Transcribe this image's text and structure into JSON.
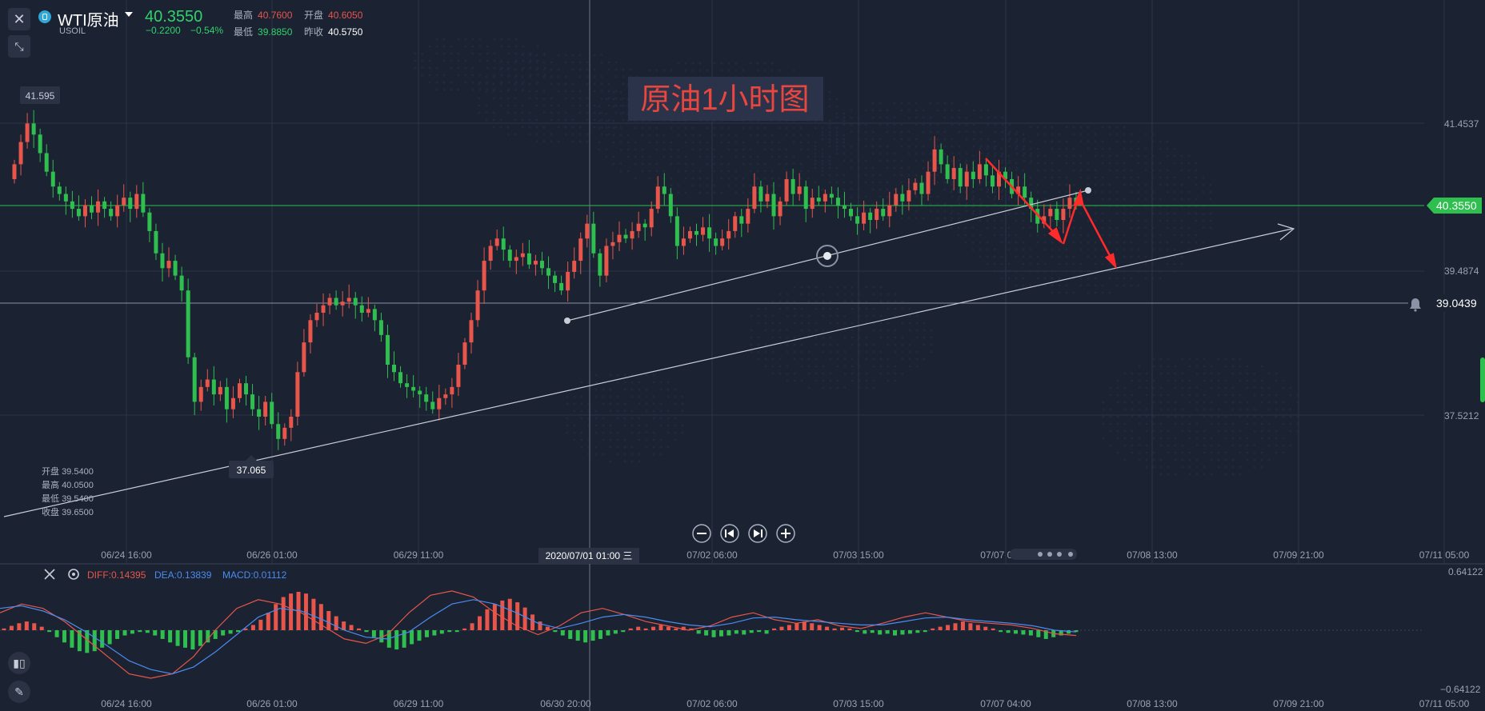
{
  "symbol": {
    "name": "WTI原油",
    "code": "USOIL"
  },
  "quote": {
    "price": "40.3550",
    "change": "−0.2200",
    "change_pct": "−0.54%",
    "high_label": "最高",
    "high": "40.7600",
    "open_label": "开盘",
    "open": "40.6050",
    "low_label": "最低",
    "low": "39.8850",
    "prev_close_label": "昨收",
    "prev_close": "40.5750"
  },
  "annotation": {
    "title": "原油1小时图"
  },
  "hover_ohlc": {
    "open_label": "开盘",
    "open": "39.5400",
    "high_label": "最高",
    "high": "40.0500",
    "low_label": "最低",
    "low": "39.5400",
    "close_label": "收盘",
    "close": "39.6500"
  },
  "price_axis": {
    "ticks": [
      "41.4537",
      "39.4874",
      "37.5212"
    ],
    "current_price": "40.3550",
    "alert_line": "39.0439",
    "max_label": "41.595",
    "min_label": "37.065"
  },
  "time_axis": {
    "main_ticks": [
      "06/24 16:00",
      "06/26 01:00",
      "06/29 11:00",
      "07/02 06:00",
      "07/03 15:00",
      "07/07 04:00",
      "07/08 13:00",
      "07/09 21:00",
      "07/11 05:00"
    ],
    "crosshair_label": "2020/07/01 01:00 三",
    "macd_ticks": [
      "06/24 16:00",
      "06/26 01:00",
      "06/29 11:00",
      "06/30 20:00",
      "07/02 06:00",
      "07/03 15:00",
      "07/07 04:00",
      "07/08 13:00",
      "07/09 21:00",
      "07/11 05:00"
    ]
  },
  "macd": {
    "diff_label": "DIFF:0.14395",
    "dea_label": "DEA:0.13839",
    "macd_label": "MACD:0.01112",
    "axis_top": "0.64122",
    "axis_bottom": "−0.64122"
  },
  "colors": {
    "up": "#e8564b",
    "down": "#2fbf4f",
    "background": "#1b2232",
    "current_price": "#2fbf4f",
    "diff": "#e8564b",
    "dea": "#4a8cf0",
    "arrow": "#ff2a2a"
  },
  "icons": [
    "close-icon",
    "compress-icon",
    "candlestick-icon",
    "pen-icon",
    "bell-icon",
    "gear-icon",
    "zoom-out-icon",
    "skip-start-icon",
    "skip-end-icon",
    "zoom-in-icon"
  ],
  "chart_data": {
    "type": "candlestick",
    "interval": "1h",
    "x_range": [
      "06/24 16:00",
      "07/11 05:00"
    ],
    "ylim": [
      36.6,
      42.0
    ],
    "closes": [
      40.9,
      41.2,
      41.45,
      41.3,
      41.05,
      40.8,
      40.6,
      40.5,
      40.4,
      40.3,
      40.2,
      40.35,
      40.25,
      40.4,
      40.3,
      40.2,
      40.35,
      40.45,
      40.3,
      40.5,
      40.25,
      40.0,
      39.7,
      39.5,
      39.6,
      39.4,
      39.2,
      38.3,
      37.7,
      37.9,
      38.0,
      37.8,
      37.9,
      37.6,
      37.75,
      37.95,
      37.8,
      37.6,
      37.5,
      37.7,
      37.4,
      37.2,
      37.35,
      37.5,
      38.1,
      38.5,
      38.8,
      38.9,
      39.0,
      39.1,
      39.0,
      39.05,
      39.1,
      39.0,
      38.9,
      38.95,
      38.8,
      38.6,
      38.2,
      38.1,
      37.95,
      37.9,
      37.85,
      37.8,
      37.7,
      37.6,
      37.75,
      37.8,
      37.9,
      38.2,
      38.5,
      38.8,
      39.2,
      39.6,
      39.8,
      39.9,
      39.75,
      39.6,
      39.65,
      39.7,
      39.55,
      39.6,
      39.5,
      39.4,
      39.3,
      39.2,
      39.45,
      39.6,
      39.9,
      40.1,
      39.7,
      39.4,
      39.8,
      39.85,
      39.95,
      39.9,
      40.0,
      40.1,
      40.05,
      40.3,
      40.6,
      40.5,
      40.2,
      39.8,
      39.9,
      40.0,
      39.95,
      40.05,
      39.9,
      39.8,
      39.9,
      40.0,
      40.2,
      40.1,
      40.3,
      40.6,
      40.4,
      40.5,
      40.2,
      40.4,
      40.7,
      40.5,
      40.6,
      40.3,
      40.45,
      40.4,
      40.5,
      40.45,
      40.35,
      40.3,
      40.2,
      40.1,
      40.25,
      40.15,
      40.3,
      40.2,
      40.35,
      40.5,
      40.4,
      40.55,
      40.65,
      40.5,
      40.8,
      41.1,
      40.9,
      40.7,
      40.85,
      40.6,
      40.8,
      40.7,
      40.9,
      40.75,
      40.6,
      40.8,
      40.7,
      40.5,
      40.6,
      40.45,
      40.3,
      40.1,
      40.2,
      40.3,
      40.15,
      40.3,
      40.45,
      40.35
    ],
    "current_price": 40.355,
    "high_point": {
      "time": "06/24 16:00",
      "value": 41.595
    },
    "low_point": {
      "time": "06/26 01:00",
      "value": 37.065
    },
    "horizontal_lines": [
      40.355,
      39.0439
    ],
    "macd": {
      "ylim": [
        -0.64122,
        0.64122
      ],
      "diff": 0.14395,
      "dea": 0.13839,
      "macd": 0.01112,
      "hist": [
        0.02,
        0.05,
        0.08,
        0.1,
        0.08,
        0.04,
        -0.02,
        -0.08,
        -0.14,
        -0.2,
        -0.24,
        -0.26,
        -0.24,
        -0.2,
        -0.16,
        -0.1,
        -0.06,
        -0.04,
        -0.02,
        -0.03,
        -0.06,
        -0.1,
        -0.14,
        -0.18,
        -0.2,
        -0.22,
        -0.18,
        -0.14,
        -0.1,
        -0.06,
        -0.04,
        -0.02,
        0.02,
        0.06,
        0.12,
        0.2,
        0.3,
        0.38,
        0.42,
        0.44,
        0.42,
        0.36,
        0.3,
        0.22,
        0.16,
        0.1,
        0.06,
        0.02,
        -0.02,
        -0.08,
        -0.14,
        -0.2,
        -0.22,
        -0.2,
        -0.16,
        -0.12,
        -0.08,
        -0.06,
        -0.04,
        -0.02,
        -0.02,
        0.02,
        0.08,
        0.16,
        0.24,
        0.3,
        0.34,
        0.36,
        0.32,
        0.26,
        0.18,
        0.1,
        0.04,
        -0.02,
        -0.06,
        -0.1,
        -0.12,
        -0.14,
        -0.12,
        -0.1,
        -0.06,
        -0.04,
        -0.02,
        0.02,
        0.04,
        0.02,
        0.04,
        0.06,
        0.04,
        0.02,
        0.04,
        0.02,
        -0.04,
        -0.06,
        -0.08,
        -0.07,
        -0.06,
        -0.04,
        -0.05,
        -0.03,
        -0.02,
        -0.04,
        0.02,
        0.04,
        0.06,
        0.08,
        0.1,
        0.08,
        0.06,
        0.04,
        0.02,
        0.03,
        0.02,
        -0.02,
        -0.04,
        -0.03,
        -0.05,
        -0.04,
        -0.06,
        -0.05,
        -0.04,
        -0.03,
        -0.02,
        0.02,
        0.04,
        0.06,
        0.08,
        0.1,
        0.08,
        0.06,
        0.04,
        0.02,
        -0.02,
        -0.03,
        -0.04,
        -0.05,
        -0.06,
        -0.08,
        -0.1,
        -0.08,
        -0.06,
        -0.04,
        -0.02
      ],
      "diff_series": [
        0.2,
        0.3,
        0.25,
        0.1,
        -0.1,
        -0.3,
        -0.5,
        -0.55,
        -0.5,
        -0.3,
        0.0,
        0.25,
        0.35,
        0.3,
        0.2,
        0.05,
        -0.1,
        -0.15,
        -0.05,
        0.2,
        0.4,
        0.45,
        0.38,
        0.2,
        0.05,
        -0.05,
        0.05,
        0.2,
        0.25,
        0.18,
        0.1,
        0.05,
        0.0,
        0.05,
        0.15,
        0.2,
        0.12,
        0.08,
        0.12,
        0.05,
        0.02,
        0.08,
        0.15,
        0.2,
        0.15,
        0.1,
        0.08,
        0.06,
        0.02,
        -0.04,
        -0.06
      ],
      "dea_series": [
        0.25,
        0.28,
        0.22,
        0.12,
        -0.02,
        -0.18,
        -0.35,
        -0.45,
        -0.5,
        -0.42,
        -0.25,
        -0.05,
        0.15,
        0.25,
        0.22,
        0.12,
        0.0,
        -0.08,
        -0.1,
        -0.02,
        0.15,
        0.3,
        0.35,
        0.3,
        0.2,
        0.08,
        0.02,
        0.08,
        0.15,
        0.18,
        0.15,
        0.1,
        0.06,
        0.04,
        0.08,
        0.14,
        0.15,
        0.12,
        0.1,
        0.08,
        0.06,
        0.06,
        0.1,
        0.14,
        0.15,
        0.12,
        0.1,
        0.08,
        0.05,
        0.0,
        -0.02
      ]
    }
  }
}
